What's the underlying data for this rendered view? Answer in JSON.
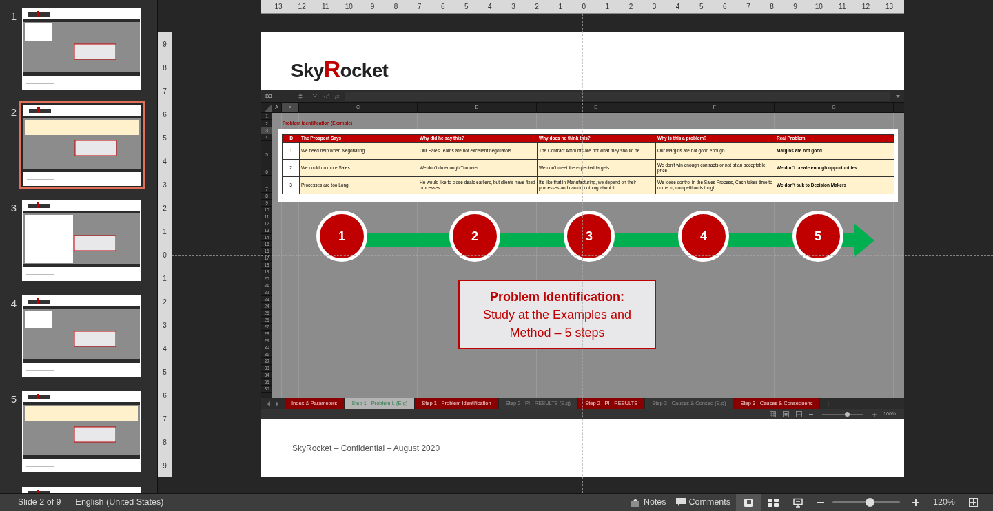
{
  "thumbnails": [
    {
      "number": "1",
      "selected": false
    },
    {
      "number": "2",
      "selected": true
    },
    {
      "number": "3",
      "selected": false
    },
    {
      "number": "4",
      "selected": false
    },
    {
      "number": "5",
      "selected": false
    },
    {
      "selected": false
    }
  ],
  "ruler": {
    "horizontal": [
      "13",
      "12",
      "11",
      "10",
      "9",
      "8",
      "7",
      "6",
      "5",
      "4",
      "3",
      "2",
      "1",
      "0",
      "1",
      "2",
      "3",
      "4",
      "5",
      "6",
      "7",
      "8",
      "9",
      "10",
      "11",
      "12",
      "13"
    ],
    "vertical": [
      "9",
      "8",
      "7",
      "6",
      "5",
      "4",
      "3",
      "2",
      "1",
      "0",
      "1",
      "2",
      "3",
      "4",
      "5",
      "6",
      "7",
      "8",
      "9"
    ]
  },
  "slide": {
    "logo": {
      "before": "Sky",
      "accent": "R",
      "after": "ocket"
    },
    "footer": "SkyRocket – Confidential – August 2020",
    "sheet": {
      "name_box": "B3",
      "fx": "fx",
      "columns": [
        {
          "label": "A",
          "selected": false
        },
        {
          "label": "B",
          "selected": true
        },
        {
          "label": "C",
          "selected": false
        },
        {
          "label": "D",
          "selected": false
        },
        {
          "label": "E",
          "selected": false
        },
        {
          "label": "F",
          "selected": false
        },
        {
          "label": "G",
          "selected": false
        }
      ],
      "rows": [
        {
          "label": "1",
          "selected": false
        },
        {
          "label": "2",
          "selected": false
        },
        {
          "label": "3",
          "selected": true
        },
        {
          "label": "4",
          "selected": false
        },
        {
          "label": "5",
          "selected": false
        },
        {
          "label": "6",
          "selected": false
        },
        {
          "label": "7",
          "selected": false
        },
        {
          "label": "8",
          "selected": false
        },
        {
          "label": "9",
          "selected": false
        },
        {
          "label": "10",
          "selected": false
        },
        {
          "label": "11",
          "selected": false
        },
        {
          "label": "12",
          "selected": false
        },
        {
          "label": "13",
          "selected": false
        },
        {
          "label": "14",
          "selected": false
        },
        {
          "label": "15",
          "selected": false
        },
        {
          "label": "16",
          "selected": false
        },
        {
          "label": "17",
          "selected": false
        },
        {
          "label": "18",
          "selected": false
        },
        {
          "label": "19",
          "selected": false
        },
        {
          "label": "20",
          "selected": false
        },
        {
          "label": "21",
          "selected": false
        },
        {
          "label": "22",
          "selected": false
        },
        {
          "label": "23",
          "selected": false
        },
        {
          "label": "24",
          "selected": false
        },
        {
          "label": "25",
          "selected": false
        },
        {
          "label": "26",
          "selected": false
        },
        {
          "label": "27",
          "selected": false
        },
        {
          "label": "28",
          "selected": false
        },
        {
          "label": "29",
          "selected": false
        },
        {
          "label": "30",
          "selected": false
        },
        {
          "label": "31",
          "selected": false
        },
        {
          "label": "32",
          "selected": false
        },
        {
          "label": "33",
          "selected": false
        },
        {
          "label": "34",
          "selected": false
        },
        {
          "label": "35",
          "selected": false
        },
        {
          "label": "36",
          "selected": false
        }
      ],
      "sheet_title": "Problem Identification (Example)",
      "table": {
        "columns": [
          "ID",
          "The Prospect Says",
          "Why did he say this?",
          "Why does he think this?",
          "Why is this a problem?",
          "Real Problem"
        ],
        "rows": [
          [
            "1",
            "We need help when Negotiating",
            "Our Sales Teams are not excellent negotiators",
            "The Contract Amounts are not what they should be",
            "Our Margins are not good enough",
            "Margins are not good"
          ],
          [
            "2",
            "We could do more Sales",
            "We don't do enough Turnover",
            "We don't meet the expected targets",
            "We don't win enough contracts or not at an acceptable price",
            "We don't create enough opportunities"
          ],
          [
            "3",
            "Processes are too Long",
            "He would like to close deals earliers, but clients have fixed processes",
            "It's like that in Manufacturing, we depend on their processes and can do nothing about it",
            "We loose control in the Sales Process, Cash takes time to come in, competition is tough.",
            "We don't talk to Decision Makers"
          ]
        ]
      },
      "steps": [
        "1",
        "2",
        "3",
        "4",
        "5"
      ],
      "callout": {
        "title": "Problem Identification:",
        "body": "Study at the Examples and Method – 5 steps"
      },
      "tabs": [
        {
          "label": "Index & Parameters",
          "selected": false,
          "color": "#8a0000"
        },
        {
          "label": "Step 1 - Problem I. (E.g)",
          "selected": true,
          "color": "#b4b4b4"
        },
        {
          "label": "Step 1 - Problem Identification",
          "selected": false,
          "color": "#8a0000"
        },
        {
          "label": "Step 2 - PI - RESULTS (E.g)",
          "selected": false,
          "color": "#353535"
        },
        {
          "label": "Step 2 - PI - RESULTS",
          "selected": false,
          "color": "#8a0000"
        },
        {
          "label": "Step 3 - Causes & Conseq (E.g)",
          "selected": false,
          "color": "#353535"
        },
        {
          "label": "Step 3 - Causes & Consequenc",
          "selected": false,
          "color": "#8a0000"
        }
      ],
      "add_tab": "+",
      "zoom": {
        "level": 0.6,
        "reading": "100%"
      }
    }
  },
  "status_bar": {
    "slide": "Slide 2 of 9",
    "language": "English (United States)",
    "notes": "Notes",
    "comments": "Comments",
    "views": [
      {
        "kind": "normal",
        "selected": true
      },
      {
        "kind": "sorter",
        "selected": false
      },
      {
        "kind": "show",
        "selected": false
      }
    ],
    "zoom": {
      "level": 0.55,
      "reading": "120%"
    }
  }
}
